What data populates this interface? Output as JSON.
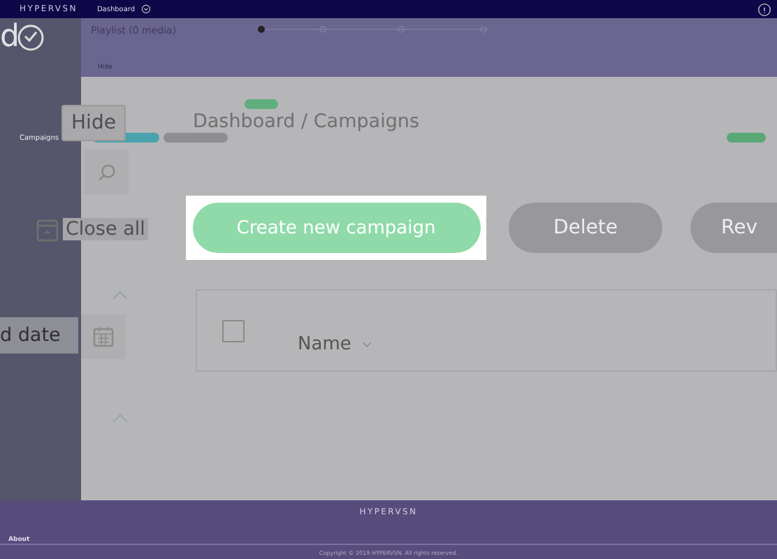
{
  "top_bar": {
    "logo": "HYPERVSN",
    "menu": "Dashboard"
  },
  "sidebar": {
    "letter": "d",
    "items": [
      {
        "label": "Campaigns",
        "selected": false
      }
    ]
  },
  "playlist_panel": {
    "title": "Playlist (0 media)",
    "hide": "Hide"
  },
  "page": {
    "hide_button": "Hide",
    "breadcrumb": "Dashboard / Campaigns",
    "close_all": "Close all",
    "date_field": "d date"
  },
  "spotlight": {
    "button": "Create new campaign"
  },
  "actions": [
    "Delete",
    "Rev"
  ],
  "table": {
    "select_all": {
      "checked": false
    },
    "columns": [
      {
        "label": "Name"
      }
    ]
  },
  "footer": {
    "logo": "HYPERVSN",
    "links": [
      "About"
    ],
    "copyright": "Copyright © 2019 HYPERVSN. All rights reserved."
  }
}
